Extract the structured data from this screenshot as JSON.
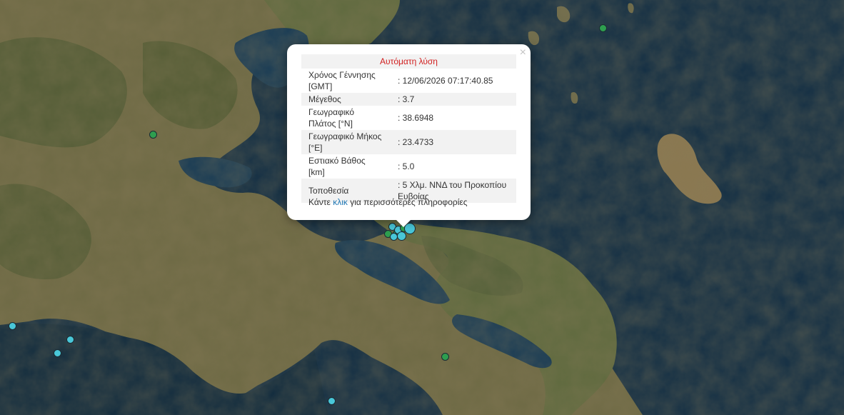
{
  "popup": {
    "title": "Αυτόματη λύση",
    "close_symbol": "×",
    "rows": [
      {
        "label": "Χρόνος Γέννησης [GMT]",
        "value": ": 12/06/2026 07:17:40.85"
      },
      {
        "label": "Μέγεθος",
        "value": ": 3.7"
      },
      {
        "label": "Γεωγραφικό Πλάτος [°N]",
        "value": ": 38.6948"
      },
      {
        "label": "Γεωγραφικό Μήκος [°E]",
        "value": ": 23.4733"
      },
      {
        "label": "Εστιακό Βάθος [km]",
        "value": ": 5.0"
      },
      {
        "label": "Τοποθεσία",
        "value": ": 5 Χλμ. ΝΝΔ του Προκοπίου Ευβοίας"
      }
    ],
    "footer": {
      "before": "Κάντε ",
      "link": "κλικ",
      "after": " για περισσότερες πληροφορίες"
    }
  },
  "colors": {
    "recent_marker": "#49c7d8",
    "older_marker": "#2e9e4f",
    "error_title": "#d11f1f",
    "link": "#1f77b4"
  },
  "icons": {
    "close": "close-icon"
  }
}
